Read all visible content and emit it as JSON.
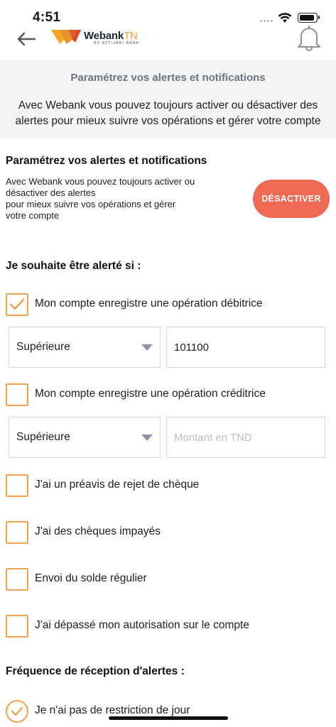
{
  "status": {
    "time": "4:51"
  },
  "header": {
    "logo_brand": "Webank",
    "logo_suffix": "TN",
    "logo_sub": "BY ATTIJARI BANK"
  },
  "banner": {
    "title": "Paramétrez vos alertes et notifications",
    "text": "Avec Webank vous pouvez toujours activer ou désactiver des alertes pour mieux suivre vos opérations et gérer votre compte"
  },
  "settings": {
    "title": "Paramétrez vos alertes et notifications",
    "desc_lines": [
      "Avec Webank vous pouvez toujours activer ou",
      "désactiver des alertes",
      "pour mieux suivre vos opérations et gérer",
      "votre compte"
    ],
    "toggle_button": "DÉSACTIVER"
  },
  "alerts": {
    "title": "Je souhaite être alerté si :",
    "debit": {
      "label": "Mon compte enregistre une opération débitrice",
      "checked": true,
      "condition": "Supérieure",
      "amount": "101100",
      "placeholder": "Montant en TND"
    },
    "credit": {
      "label": "Mon compte enregistre une opération créditrice",
      "checked": false,
      "condition": "Supérieure",
      "amount": "",
      "placeholder": "Montant en TND"
    },
    "cheque_reject": {
      "label": "J'ai un préavis de rejet de chèque",
      "checked": false
    },
    "unpaid": {
      "label": "J'ai des chèques impayés",
      "checked": false
    },
    "balance": {
      "label": "Envoi du solde régulier",
      "checked": false
    },
    "overdraft": {
      "label": "J'ai dépassé mon autorisation sur le compte",
      "checked": false
    }
  },
  "frequency": {
    "title": "Fréquence de réception d'alertes :",
    "option": "Je n'ai pas de restriction de jour",
    "selected": true
  },
  "colors": {
    "accent": "#eea351",
    "button": "#ef6a53",
    "banner_bg": "#f4f4f4"
  }
}
